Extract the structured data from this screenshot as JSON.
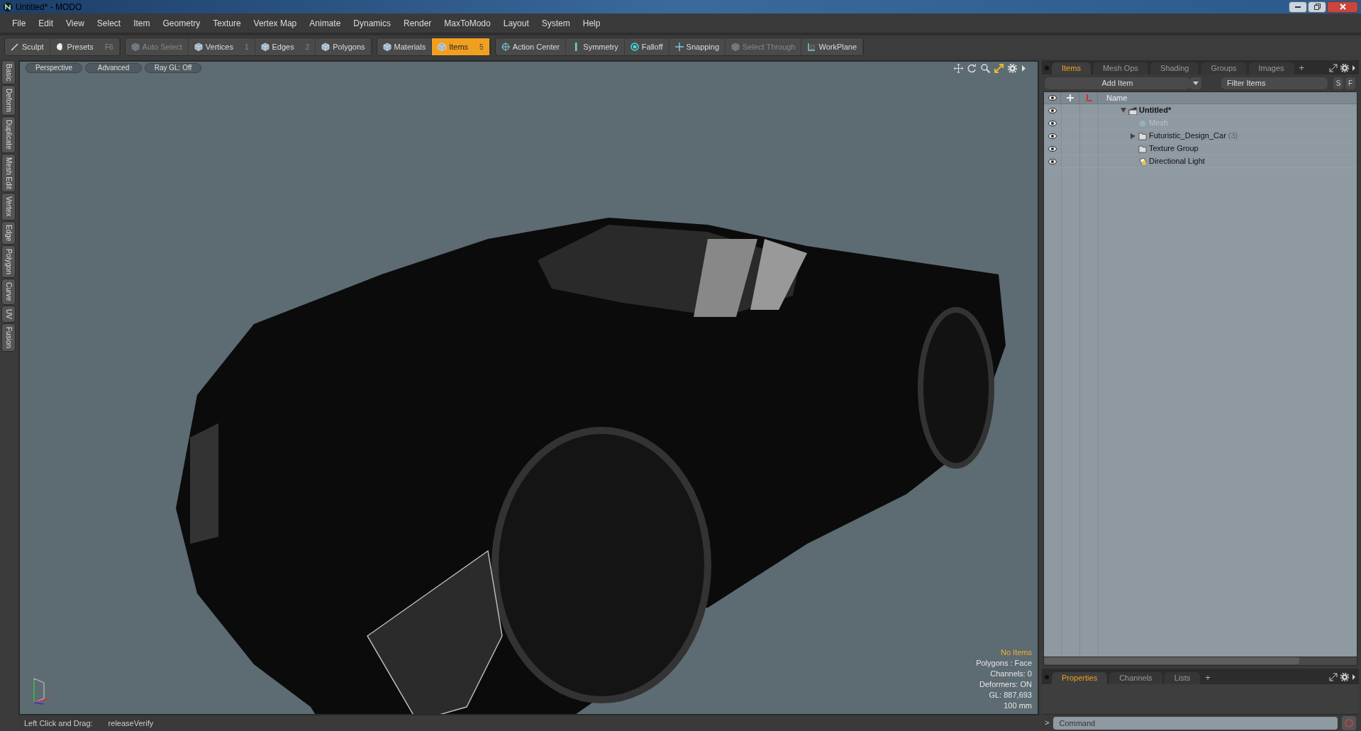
{
  "window": {
    "title": "Untitled* - MODO"
  },
  "menu": [
    "File",
    "Edit",
    "View",
    "Select",
    "Item",
    "Geometry",
    "Texture",
    "Vertex Map",
    "Animate",
    "Dynamics",
    "Render",
    "MaxToModo",
    "Layout",
    "System",
    "Help"
  ],
  "toolbar": [
    [
      {
        "label": "Sculpt",
        "kind": "brush",
        "selected": false,
        "disabled": false
      },
      {
        "label": "Presets",
        "shortcut": "F6",
        "kind": "ball",
        "selected": false,
        "disabled": false
      }
    ],
    [
      {
        "label": "Auto Select",
        "kind": "cube",
        "selected": false,
        "disabled": true
      },
      {
        "label": "Vertices",
        "shortcut": "1",
        "kind": "cube",
        "selected": false,
        "disabled": false
      },
      {
        "label": "Edges",
        "shortcut": "2",
        "kind": "cube",
        "selected": false,
        "disabled": false
      },
      {
        "label": "Polygons",
        "kind": "cube",
        "selected": false,
        "disabled": false
      }
    ],
    [
      {
        "label": "Materials",
        "kind": "cube",
        "selected": false,
        "disabled": false
      },
      {
        "label": "Items",
        "shortcut": "5",
        "kind": "cube",
        "selected": true,
        "disabled": false
      }
    ],
    [
      {
        "label": "Action Center",
        "kind": "target",
        "selected": false,
        "disabled": false
      },
      {
        "label": "Symmetry",
        "kind": "bar",
        "selected": false,
        "disabled": false
      },
      {
        "label": "Falloff",
        "kind": "ring",
        "selected": false,
        "disabled": false
      },
      {
        "label": "Snapping",
        "kind": "cross",
        "selected": false,
        "disabled": false
      },
      {
        "label": "Select Through",
        "kind": "cube",
        "selected": false,
        "disabled": true
      },
      {
        "label": "WorkPlane",
        "kind": "grid",
        "selected": false,
        "disabled": false
      }
    ]
  ],
  "left_tabs": [
    "Basic",
    "Deform",
    "Duplicate",
    "Mesh Edit",
    "Vertex",
    "Edge",
    "Polygon",
    "Curve",
    "UV",
    "Fusion"
  ],
  "viewport": {
    "tabs": [
      "Perspective",
      "Advanced",
      "Ray GL: Off"
    ],
    "info": [
      {
        "text": "No Items",
        "kind": "title"
      },
      {
        "text": "Polygons : Face",
        "kind": "stat"
      },
      {
        "text": "Channels: 0",
        "kind": "stat"
      },
      {
        "text": "Deformers: ON",
        "kind": "stat"
      },
      {
        "text": "GL: 887,693",
        "kind": "stat"
      },
      {
        "text": "100 mm",
        "kind": "stat"
      }
    ]
  },
  "items_panel": {
    "tabs": [
      {
        "label": "Items",
        "selected": true
      },
      {
        "label": "Mesh Ops",
        "selected": false
      },
      {
        "label": "Shading",
        "selected": false
      },
      {
        "label": "Groups",
        "selected": false
      },
      {
        "label": "Images",
        "selected": false
      }
    ],
    "add_tab": "+",
    "add_item": "Add Item",
    "filter": {
      "placeholder": "Filter Items"
    },
    "buttons": [
      "S",
      "F"
    ],
    "columns": {
      "name": "Name"
    },
    "tree": [
      {
        "label": "Untitled*",
        "kind": "scene",
        "disabled": false,
        "expanded": true,
        "children": [
          {
            "label": "Mesh",
            "kind": "mesh",
            "disabled": true
          },
          {
            "label": "Futuristic_Design_Car",
            "count": "(3)",
            "kind": "group",
            "disabled": false,
            "expanded": false
          },
          {
            "label": "Texture Group",
            "kind": "group",
            "disabled": false
          },
          {
            "label": "Directional Light",
            "kind": "light",
            "disabled": false
          }
        ]
      }
    ]
  },
  "properties_panel": {
    "tabs": [
      {
        "label": "Properties",
        "selected": true
      },
      {
        "label": "Channels",
        "selected": false
      },
      {
        "label": "Lists",
        "selected": false
      }
    ],
    "add_tab": "+"
  },
  "command": {
    "prompt": ">",
    "placeholder": "Command"
  },
  "status_bar": {
    "action": "Left Click and Drag:",
    "command": "releaseVerify"
  }
}
